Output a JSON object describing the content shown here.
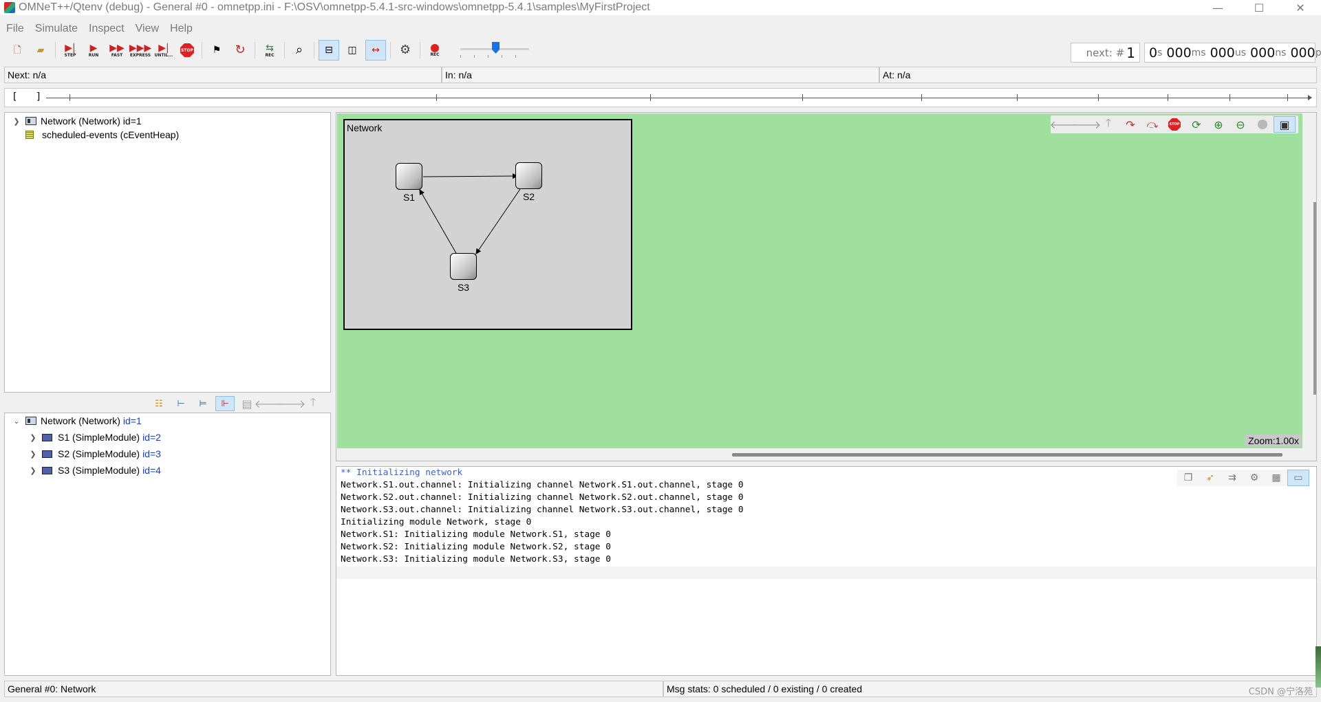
{
  "window": {
    "title": "OMNeT++/Qtenv (debug) - General #0 - omnetpp.ini - F:\\OSV\\omnetpp-5.4.1-src-windows\\omnetpp-5.4.1\\samples\\MyFirstProject",
    "minimize": "—",
    "maximize": "☐",
    "close": "✕"
  },
  "menu": [
    "File",
    "Simulate",
    "Inspect",
    "View",
    "Help"
  ],
  "toolbar": {
    "step": "STEP",
    "run": "RUN",
    "fast": "FAST",
    "express": "EXPRESS",
    "until": "UNTIL...",
    "stop": "STOP",
    "rec": "REC",
    "record_rec": "REC"
  },
  "event_counter": {
    "label": "next: #",
    "value": "1"
  },
  "sim_time": {
    "s": "0",
    "s_unit": "s",
    "ms": "000",
    "ms_unit": "ms",
    "us": "000",
    "us_unit": "us",
    "ns": "000",
    "ns_unit": "ns",
    "ps": "000",
    "ps_unit": "ps"
  },
  "status": {
    "next": "Next: n/a",
    "in": "In: n/a",
    "at": "At: n/a"
  },
  "timeline": {
    "brackets": "[ ]"
  },
  "object_tree": {
    "items": [
      {
        "label": "Network (Network) id=1"
      },
      {
        "label": "scheduled-events (cEventHeap)"
      }
    ]
  },
  "module_tree": {
    "root": {
      "label": "Network (Network)",
      "id": "id=1"
    },
    "children": [
      {
        "label": "S1 (SimpleModule)",
        "id": "id=2"
      },
      {
        "label": "S2 (SimpleModule)",
        "id": "id=3"
      },
      {
        "label": "S3 (SimpleModule)",
        "id": "id=4"
      }
    ]
  },
  "network": {
    "name": "Network",
    "nodes": [
      {
        "label": "S1"
      },
      {
        "label": "S2"
      },
      {
        "label": "S3"
      }
    ]
  },
  "canvas": {
    "zoom": "Zoom:1.00x"
  },
  "log": {
    "lines": [
      "** Initializing network",
      "Network.S1.out.channel: Initializing channel Network.S1.out.channel, stage 0",
      "Network.S2.out.channel: Initializing channel Network.S2.out.channel, stage 0",
      "Network.S3.out.channel: Initializing channel Network.S3.out.channel, stage 0",
      "Initializing module Network, stage 0",
      "Network.S1: Initializing module Network.S1, stage 0",
      "Network.S2: Initializing module Network.S2, stage 0",
      "Network.S3: Initializing module Network.S3, stage 0"
    ]
  },
  "bottom_status": {
    "config": "General #0: Network",
    "msg_stats": "Msg stats: 0 scheduled / 0 existing / 0 created"
  },
  "watermark": "CSDN @宁洛苑",
  "colors": {
    "canvas_bg": "#a0e09e",
    "network_bg": "#d3d3d3",
    "id_link": "#1a3bd0",
    "log_header": "#3a5fd8",
    "stop_red": "#e02020",
    "active_btn": "#cfe5fa"
  }
}
